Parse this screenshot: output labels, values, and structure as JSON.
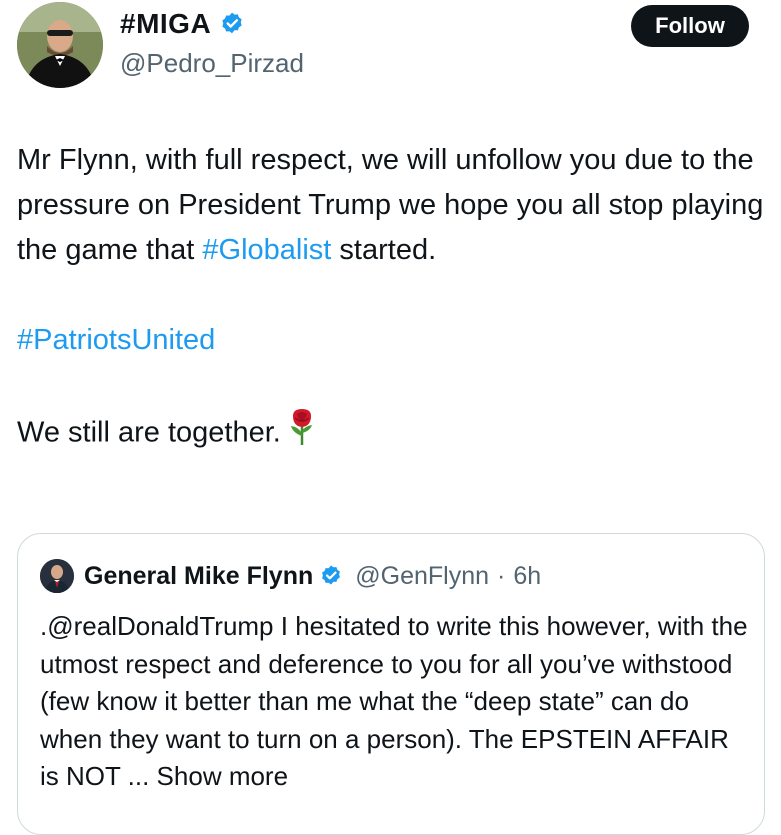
{
  "author": {
    "display_name": "#MIGA",
    "handle": "@Pedro_Pirzad"
  },
  "follow_label": "Follow",
  "tweet": {
    "line1": "Mr Flynn, with full respect, we will unfollow you due to the pressure on President Trump we hope you all stop playing the game that ",
    "hashtag1": "#Globalist",
    "line1_end": " started.",
    "hashtag2": "#PatriotsUnited",
    "line3": "We still are together."
  },
  "quote": {
    "display_name": "General Mike Flynn",
    "handle": "@GenFlynn",
    "separator": "·",
    "time": "6h",
    "text": ".@realDonaldTrump I hesitated to write this however, with the utmost respect and deference to you for all you’ve withstood (few know it better than me what the “deep state” can do when they want to turn on a person). The EPSTEIN AFFAIR is NOT",
    "show_more": "... Show more"
  },
  "colors": {
    "link": "#1d9bf0",
    "verified": "#1d9bf0",
    "secondary_text": "#536471",
    "border": "#cfd9de"
  },
  "icons": {
    "verified": "verified-badge-icon",
    "emoji": "rose-icon"
  }
}
